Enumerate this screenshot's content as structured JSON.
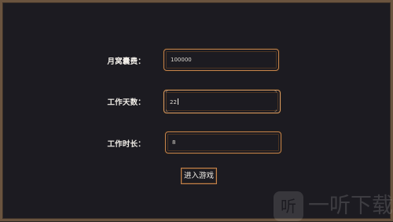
{
  "form": {
    "rent_label": "月窝囊费：",
    "rent_value": "100000",
    "days_label": "工作天数：",
    "days_value": "22",
    "hours_label": "工作时长：",
    "hours_value": "8"
  },
  "enter_button_label": "进入游戏",
  "watermark": {
    "logo_glyph": "听",
    "text": "一听下载"
  }
}
